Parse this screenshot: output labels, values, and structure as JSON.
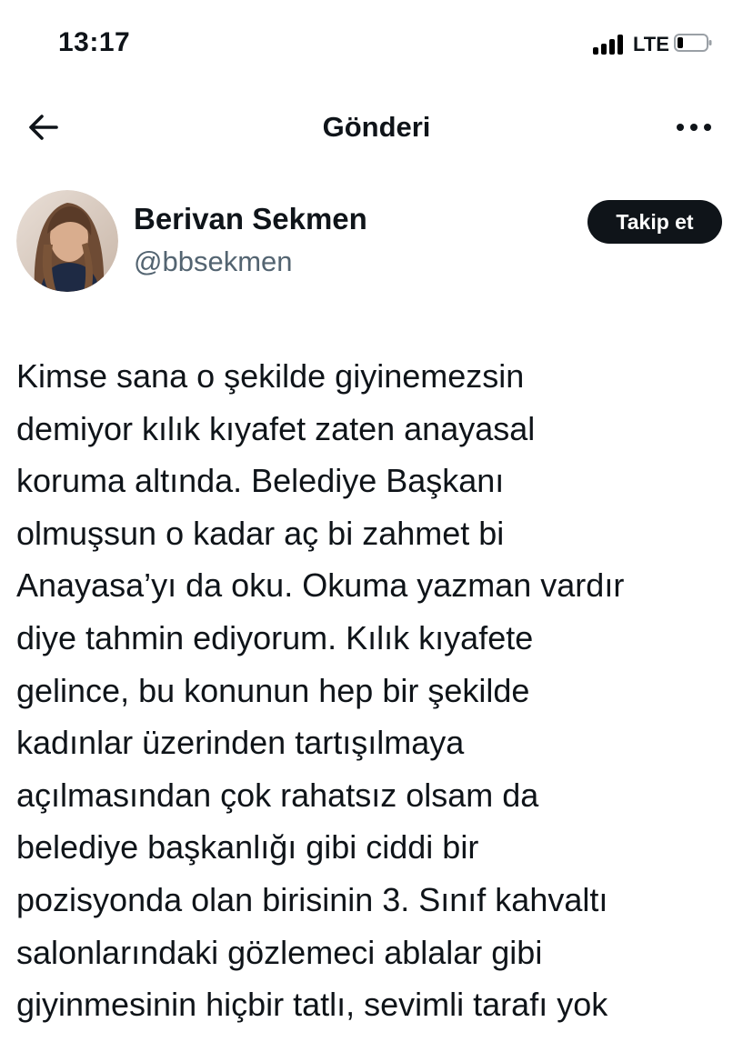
{
  "status_bar": {
    "time": "13:17",
    "network": "LTE",
    "signal_bars": 4,
    "battery_level": 0.2
  },
  "header": {
    "title": "Gönderi",
    "back_icon": "arrow-left-icon",
    "more_icon": "more-horizontal-icon"
  },
  "post": {
    "author": {
      "display_name": "Berivan Sekmen",
      "handle": "@bbsekmen"
    },
    "follow_label": "Takip et",
    "lines": [
      "Kimse sana o şekilde giyinemezsin",
      "demiyor kılık kıyafet zaten anayasal",
      "koruma altında. Belediye Başkanı",
      "olmuşsun o kadar aç bi zahmet bi",
      "Anayasa’yı da oku. Okuma yazman vardır",
      "diye tahmin ediyorum. Kılık kıyafete",
      "gelince, bu konunun hep bir şekilde",
      "kadınlar üzerinden tartışılmaya",
      "açılmasından çok rahatsız olsam da",
      "belediye başkanlığı gibi ciddi bir",
      "pozisyonda olan birisinin 3. Sınıf kahvaltı",
      "salonlarındaki gözlemeci ablalar gibi",
      "giyinmesinin hiçbir tatlı, sevimli tarafı yok"
    ]
  },
  "colors": {
    "text_primary": "#0f1419",
    "text_secondary": "#536471",
    "button_bg": "#0f1419",
    "button_text": "#ffffff"
  }
}
